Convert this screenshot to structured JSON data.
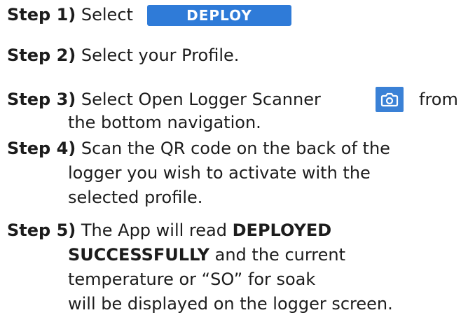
{
  "step1": {
    "label": "Step 1)",
    "text": "Select",
    "button_label": "DEPLOY",
    "button_color": "#2f7bd8"
  },
  "step2": {
    "label": "Step 2)",
    "text": "Select your Profile."
  },
  "step3": {
    "label": "Step 3)",
    "text_before": "Select Open Logger Scanner",
    "icon": "camera-icon",
    "text_after": "from",
    "line2": "the bottom navigation."
  },
  "step4": {
    "label": "Step 4)",
    "line1": "Scan the QR code on the back of the",
    "line2": "logger you wish to activate with the",
    "line3": "selected profile."
  },
  "step5": {
    "label": "Step 5)",
    "line1_plain": "The App will read",
    "line1_bold": "DEPLOYED",
    "line2_bold": "SUCCESSFULLY",
    "line2_plain": "and the current",
    "line3": "temperature or “SO” for soak",
    "line4": "will be displayed on the logger screen."
  }
}
